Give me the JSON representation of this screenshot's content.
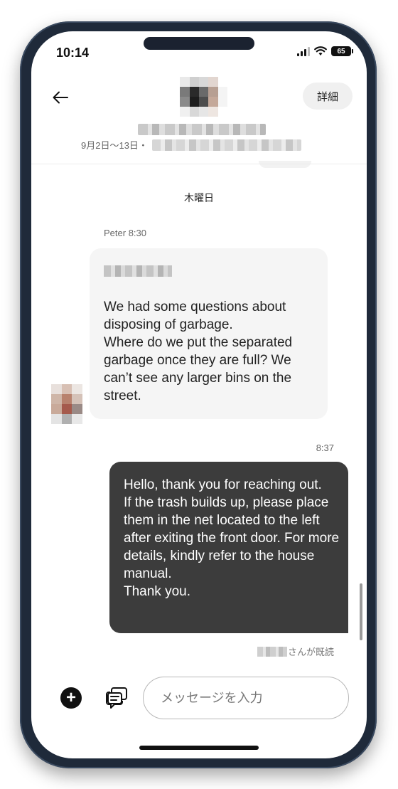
{
  "status_bar": {
    "time": "10:14",
    "battery": "65",
    "icons": [
      "cellular-signal-icon",
      "wifi-icon",
      "battery-icon"
    ]
  },
  "header": {
    "back_icon": "arrow-left-icon",
    "details_label": "詳細",
    "dates": "9月2日〜13日・"
  },
  "chat": {
    "day_label": "木曜日",
    "incoming": {
      "sender": "Peter",
      "time": "8:30",
      "text": "We had some questions about disposing of garbage.\nWhere do we put the separated garbage once they are full? We can’t see any larger bins on the street."
    },
    "outgoing": {
      "time": "8:37",
      "text": "Hello, thank you for reaching out.\nIf the trash builds up, please place them in the net located to the left after exiting the front door. For more details, kindly refer to the house manual.\nThank you."
    },
    "read_receipt": "さんが既読"
  },
  "composer": {
    "add_icon": "plus-circle-icon",
    "templates_icon": "message-templates-icon",
    "placeholder": "メッセージを入力"
  },
  "colors": {
    "outgoing_bubble": "#3c3c3c",
    "incoming_bubble": "#f5f5f5",
    "frame": "#1f2a3a"
  }
}
